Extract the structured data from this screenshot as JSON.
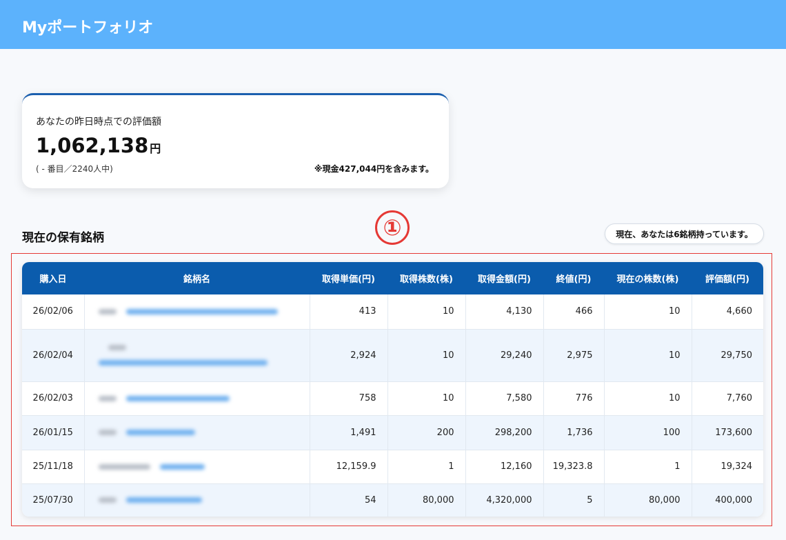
{
  "header": {
    "title": "Myポートフォリオ"
  },
  "summary": {
    "label": "あなたの昨日時点での評価額",
    "value": "1,062,138",
    "unit": "円",
    "rank": "( - 番目／2240人中)",
    "cash_note": "※現金427,044円を含みます。"
  },
  "section": {
    "title": "現在の保有銘柄"
  },
  "annotation": {
    "marker": "①"
  },
  "badge": {
    "text": "現在、あなたは6銘柄持っています。"
  },
  "table": {
    "columns": [
      "購入日",
      "銘柄名",
      "取得単価(円)",
      "取得株数(株)",
      "取得金額(円)",
      "終値(円)",
      "現在の株数(株)",
      "評価額(円)"
    ],
    "rows": [
      {
        "date": "26/02/06",
        "unit_price": "413",
        "shares": "10",
        "cost": "4,130",
        "close": "466",
        "current_shares": "10",
        "valuation": "4,660"
      },
      {
        "date": "26/02/04",
        "unit_price": "2,924",
        "shares": "10",
        "cost": "29,240",
        "close": "2,975",
        "current_shares": "10",
        "valuation": "29,750"
      },
      {
        "date": "26/02/03",
        "unit_price": "758",
        "shares": "10",
        "cost": "7,580",
        "close": "776",
        "current_shares": "10",
        "valuation": "7,760"
      },
      {
        "date": "26/01/15",
        "unit_price": "1,491",
        "shares": "200",
        "cost": "298,200",
        "close": "1,736",
        "current_shares": "100",
        "valuation": "173,600"
      },
      {
        "date": "25/11/18",
        "unit_price": "12,159.9",
        "shares": "1",
        "cost": "12,160",
        "close": "19,323.8",
        "current_shares": "1",
        "valuation": "19,324"
      },
      {
        "date": "25/07/30",
        "unit_price": "54",
        "shares": "80,000",
        "cost": "4,320,000",
        "close": "5",
        "current_shares": "80,000",
        "valuation": "400,000"
      }
    ]
  },
  "colors": {
    "header_bg": "#5cb2fc",
    "table_header_bg": "#0b5cad",
    "annotation_red": "#e53935",
    "row_alt_bg": "#eef5fd"
  }
}
